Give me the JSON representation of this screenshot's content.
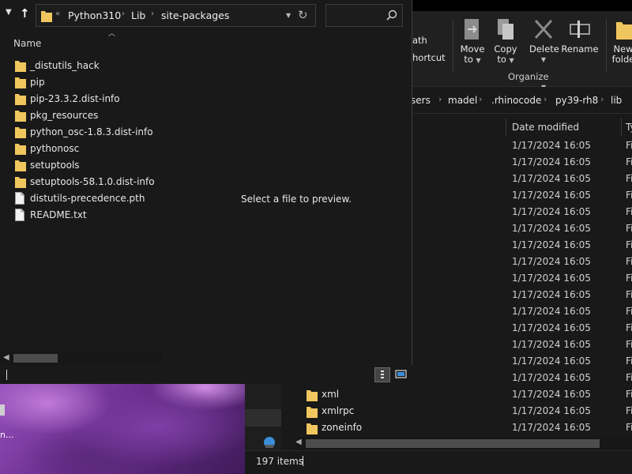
{
  "foreground": {
    "address": {
      "segments": [
        "Python310",
        "Lib",
        "site-packages"
      ],
      "prefix_chevron": "«"
    },
    "search": {
      "placeholder": "",
      "value": ""
    },
    "column_header": "Name",
    "items": [
      {
        "name": "_distutils_hack",
        "icon": "folder-icon"
      },
      {
        "name": "pip",
        "icon": "folder-icon"
      },
      {
        "name": "pip-23.3.2.dist-info",
        "icon": "folder-icon"
      },
      {
        "name": "pkg_resources",
        "icon": "folder-icon"
      },
      {
        "name": "python_osc-1.8.3.dist-info",
        "icon": "folder-icon"
      },
      {
        "name": "pythonosc",
        "icon": "folder-icon"
      },
      {
        "name": "setuptools",
        "icon": "folder-icon"
      },
      {
        "name": "setuptools-58.1.0.dist-info",
        "icon": "folder-icon"
      },
      {
        "name": "distutils-precedence.pth",
        "icon": "file-icon"
      },
      {
        "name": "README.txt",
        "icon": "file-icon"
      }
    ],
    "preview_message": "Select a file to preview."
  },
  "background": {
    "ribbon": {
      "copy_path_fragment": "ath",
      "paste_shortcut_fragment": "hortcut",
      "move_to": {
        "line1": "Move",
        "line2": "to"
      },
      "copy_to": {
        "line1": "Copy",
        "line2": "to"
      },
      "delete": "Delete",
      "rename": "Rename",
      "new_folder": {
        "line1": "New",
        "line2": "folde"
      },
      "organize_label": "Organize"
    },
    "breadcrumb": [
      "sers",
      "madel",
      ".rhinocode",
      "py39-rh8",
      "lib"
    ],
    "columns": {
      "date_modified": "Date modified",
      "type_fragment": "Ty"
    },
    "rows": [
      {
        "name": "",
        "date": "1/17/2024 16:05",
        "type": "Fi"
      },
      {
        "name": "",
        "date": "1/17/2024 16:05",
        "type": "Fi"
      },
      {
        "name": "",
        "date": "1/17/2024 16:05",
        "type": "Fi"
      },
      {
        "name": "",
        "date": "1/17/2024 16:05",
        "type": "Fi"
      },
      {
        "name": "",
        "date": "1/17/2024 16:05",
        "type": "Fi"
      },
      {
        "name": "",
        "date": "1/17/2024 16:05",
        "type": "Fi"
      },
      {
        "name": "",
        "date": "1/17/2024 16:05",
        "type": "Fi"
      },
      {
        "name": "",
        "date": "1/17/2024 16:05",
        "type": "Fi"
      },
      {
        "name": "",
        "date": "1/17/2024 16:05",
        "type": "Fi"
      },
      {
        "name": "",
        "date": "1/17/2024 16:05",
        "type": "Fi"
      },
      {
        "name": "",
        "date": "1/17/2024 16:05",
        "type": "Fi"
      },
      {
        "name": "",
        "date": "1/17/2024 16:05",
        "type": "Fi"
      },
      {
        "name": "",
        "date": "1/17/2024 16:05",
        "type": "Fi"
      },
      {
        "name": "",
        "date": "1/17/2024 16:05",
        "type": "Fi"
      },
      {
        "name": "",
        "date": "1/17/2024 16:05",
        "type": "Fi"
      },
      {
        "name": "xml",
        "date": "1/17/2024 16:05",
        "type": "Fi"
      },
      {
        "name": "xmlrpc",
        "date": "1/17/2024 16:05",
        "type": "Fi"
      },
      {
        "name": "zoneinfo",
        "date": "1/17/2024 16:05",
        "type": "Fi"
      }
    ],
    "status": {
      "item_count": "197 items"
    }
  },
  "desktop": {
    "icon_label_fragment": "n..."
  },
  "colors": {
    "window_bg": "#191919",
    "ribbon_bg": "#202020",
    "folder_yellow": "#f0c75e",
    "text": "#e8e8e8"
  }
}
